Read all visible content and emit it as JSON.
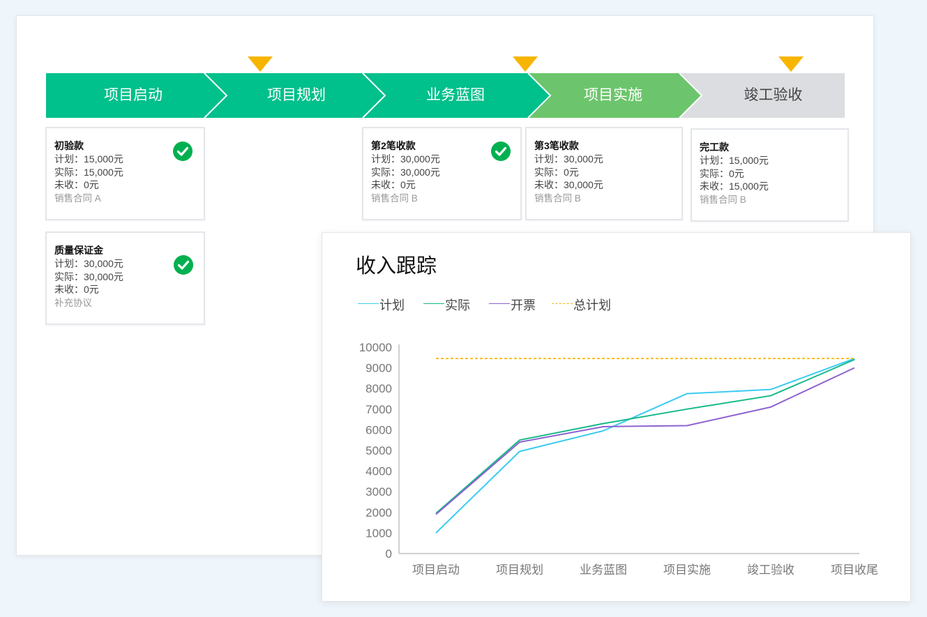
{
  "stages": [
    {
      "label": "项目启动",
      "status": "done"
    },
    {
      "label": "项目规划",
      "status": "done"
    },
    {
      "label": "业务蓝图",
      "status": "done"
    },
    {
      "label": "项目实施",
      "status": "current"
    },
    {
      "label": "竣工验收",
      "status": "pending"
    }
  ],
  "colors": {
    "done": "#00c08b",
    "current": "#6cc56c",
    "pending": "#dcdde0",
    "marker": "#f7b500",
    "check": "#00b050"
  },
  "cards": [
    {
      "title": "初验款",
      "plan": "计划：15,000元",
      "actual": "实际：15,000元",
      "unpaid": "未收：0元",
      "contract": "销售合同 A",
      "completed": true
    },
    {
      "title": "质量保证金",
      "plan": "计划：30,000元",
      "actual": "实际：30,000元",
      "unpaid": "未收：0元",
      "contract": "补充协议",
      "completed": true
    },
    {
      "title": "第2笔收款",
      "plan": "计划：30,000元",
      "actual": "实际：30,000元",
      "unpaid": "未收：0元",
      "contract": "销售合同 B",
      "completed": true
    },
    {
      "title": "第3笔收款",
      "plan": "计划：30,000元",
      "actual": "实际：0元",
      "unpaid": "未收：30,000元",
      "contract": "销售合同 B",
      "completed": false
    },
    {
      "title": "完工款",
      "plan": "计划：15,000元",
      "actual": "实际：0元",
      "unpaid": "未收：15,000元",
      "contract": "销售合同 B",
      "completed": false
    }
  ],
  "chart": {
    "title": "收入跟踪"
  },
  "chart_data": {
    "type": "line",
    "categories": [
      "项目启动",
      "项目规划",
      "业务蓝图",
      "项目实施",
      "竣工验收",
      "项目收尾"
    ],
    "ylim": [
      0,
      10000
    ],
    "yticks": [
      0,
      1000,
      2000,
      3000,
      4000,
      5000,
      6000,
      7000,
      8000,
      9000,
      10000
    ],
    "grid": false,
    "legend_position": "top-left",
    "series": [
      {
        "name": "计划",
        "color": "#3ccbf0",
        "dashed": false,
        "values": [
          1000,
          4950,
          5950,
          7750,
          7950,
          9450
        ]
      },
      {
        "name": "实际",
        "color": "#16b98b",
        "dashed": false,
        "values": [
          1950,
          5500,
          6300,
          7000,
          7650,
          9400
        ]
      },
      {
        "name": "开票",
        "color": "#8e62d0",
        "dashed": false,
        "values": [
          1900,
          5400,
          6150,
          6200,
          7100,
          9000
        ]
      },
      {
        "name": "总计划",
        "color": "#f7b500",
        "dashed": true,
        "values": [
          9450,
          9450,
          9450,
          9450,
          9450,
          9450
        ]
      }
    ]
  }
}
